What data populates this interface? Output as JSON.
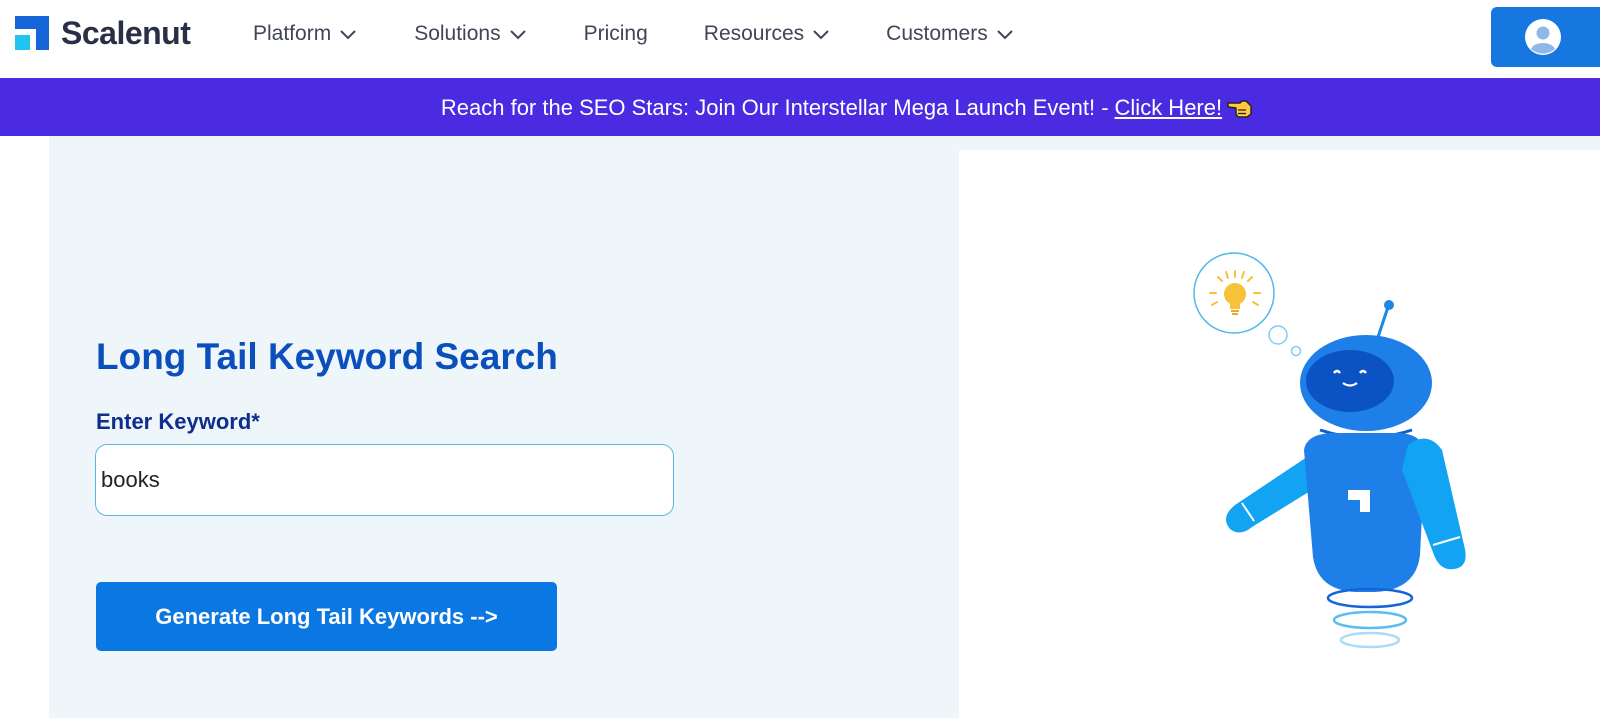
{
  "header": {
    "brand": "Scalenut",
    "nav": [
      {
        "label": "Platform",
        "has_dropdown": true
      },
      {
        "label": "Solutions",
        "has_dropdown": true
      },
      {
        "label": "Pricing",
        "has_dropdown": false
      },
      {
        "label": "Resources",
        "has_dropdown": true
      },
      {
        "label": "Customers",
        "has_dropdown": true
      }
    ],
    "profile_icon": "user-avatar-icon"
  },
  "banner": {
    "text": "Reach for the SEO Stars: Join Our Interstellar Mega Launch Event! -",
    "link_label": "Click Here!",
    "icon": "pointing-hand-icon"
  },
  "main": {
    "title": "Long Tail Keyword Search",
    "field_label": "Enter Keyword*",
    "keyword_value": "books",
    "button_label": "Generate Long Tail Keywords -->"
  },
  "illustration": {
    "name": "robot-mascot",
    "thought_icon": "lightbulb-icon"
  },
  "colors": {
    "brand_blue": "#0b77e3",
    "banner_purple": "#4a2be1",
    "title_blue": "#0b4fbd",
    "panel_bg": "#eff6fa"
  }
}
